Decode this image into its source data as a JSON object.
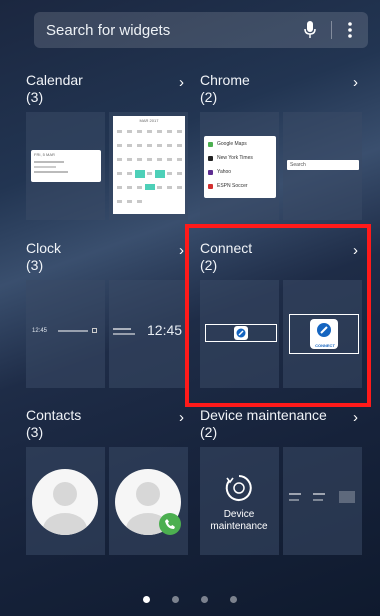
{
  "search": {
    "placeholder": "Search for widgets",
    "mic_icon": "mic-icon",
    "more_icon": "more-vertical-icon"
  },
  "groups": [
    {
      "title": "Calendar",
      "count": "(3)",
      "thumb_text": {
        "calendar_card_head": "FRI, 5 MAR",
        "month": "MAR 2017"
      }
    },
    {
      "title": "Chrome",
      "count": "(2)",
      "bookmarks": [
        "Google Maps",
        "New York Times",
        "Yahoo",
        "ESPN Soccer"
      ],
      "search_text": "Search"
    },
    {
      "title": "Clock",
      "count": "(3)",
      "time_small": "12:45",
      "time": "12:45"
    },
    {
      "title": "Connect",
      "count": "(2)",
      "connect_label": "CONNECT"
    },
    {
      "title": "Contacts",
      "count": "(3)"
    },
    {
      "title": "Device maintenance",
      "count": "(2)",
      "device_label": "Device maintenance"
    }
  ],
  "colors": {
    "highlight": "#ff1a1a",
    "accent_green": "#4caf50",
    "connect_blue": "#1565c0"
  },
  "page_indicator": {
    "total": 4,
    "active": 1
  }
}
